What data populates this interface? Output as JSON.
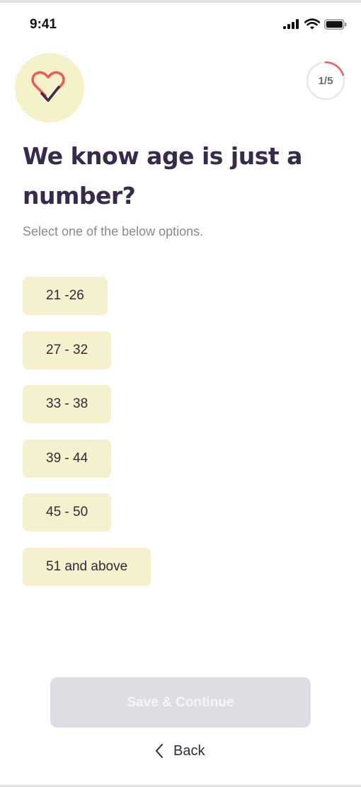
{
  "status_bar": {
    "time": "9:41",
    "icons": [
      "signal-icon",
      "wifi-icon",
      "battery-icon"
    ]
  },
  "logo": {
    "icon": "heart-check-icon"
  },
  "progress": {
    "label": "1/5",
    "fraction": 0.2,
    "accent": "#f05a5a"
  },
  "question": {
    "title": "We know age is just a number?",
    "subtitle": "Select one of the below options."
  },
  "options": [
    {
      "label": "21 -26"
    },
    {
      "label": "27 - 32"
    },
    {
      "label": "33 - 38"
    },
    {
      "label": "39 - 44"
    },
    {
      "label": "45 - 50"
    },
    {
      "label": "51 and above"
    }
  ],
  "footer": {
    "save_label": "Save & Continue",
    "back_label": "Back",
    "back_icon": "chevron-left-icon"
  },
  "colors": {
    "title": "#372a4b",
    "option_bg": "#f5f1ce",
    "logo_bg": "#f5f1c9",
    "button_disabled_bg": "#dedde3",
    "heart": "#f05a5a"
  }
}
